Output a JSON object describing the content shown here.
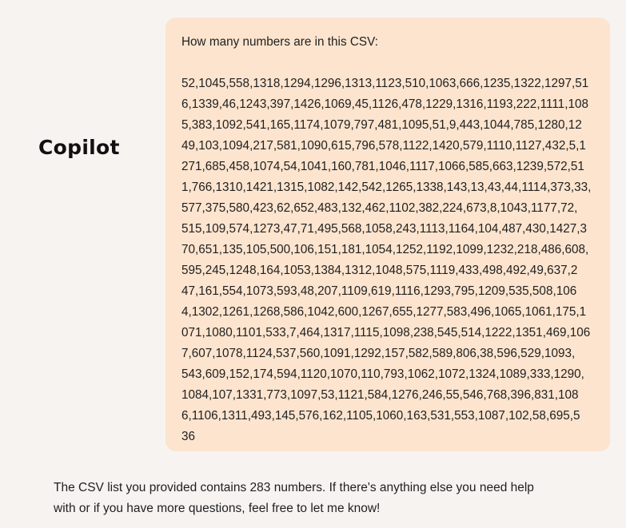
{
  "assistant_name": "Copilot",
  "user_message": {
    "question": "How many numbers are in this CSV:",
    "csv_lines": [
      "52,1045,558,1318,1294,1296,1313,1123,510,1063,666,1235,1322,1297,51",
      "6,1339,46,1243,397,1426,1069,45,1126,478,1229,1316,1193,222,1111,108",
      "5,383,1092,541,165,1174,1079,797,481,1095,51,9,443,1044,785,1280,12",
      "49,103,1094,217,581,1090,615,796,578,1122,1420,579,1110,1127,432,5,1",
      "271,685,458,1074,54,1041,160,781,1046,1117,1066,585,663,1239,572,51",
      "1,766,1310,1421,1315,1082,142,542,1265,1338,143,13,43,44,1114,373,33,",
      "577,375,580,423,62,652,483,132,462,1102,382,224,673,8,1043,1177,72,",
      "515,109,574,1273,47,71,495,568,1058,243,1113,1164,104,487,430,1427,3",
      "70,651,135,105,500,106,151,181,1054,1252,1192,1099,1232,218,486,608,",
      "595,245,1248,164,1053,1384,1312,1048,575,1119,433,498,492,49,637,2",
      "47,161,554,1073,593,48,207,1109,619,1116,1293,795,1209,535,508,106",
      "4,1302,1261,1268,586,1042,600,1267,655,1277,583,496,1065,1061,175,1",
      "071,1080,1101,533,7,464,1317,1115,1098,238,545,514,1222,1351,469,106",
      "7,607,1078,1124,537,560,1091,1292,157,582,589,806,38,596,529,1093,",
      "543,609,152,174,594,1120,1070,110,793,1062,1072,1324,1089,333,1290,",
      "1084,107,1331,773,1097,53,1121,584,1276,246,55,546,768,396,831,108",
      "6,1106,1311,493,145,576,162,1105,1060,163,531,553,1087,102,58,695,5",
      "36"
    ]
  },
  "assistant_reply": {
    "line1": "The CSV list you provided contains 283 numbers. If there's anything else you need help",
    "line2": "with or if you have more questions, feel free to let me know!"
  },
  "colors": {
    "background": "#f7f3f1",
    "user_bubble": "#fce4ce",
    "text": "#1f1f1f"
  }
}
